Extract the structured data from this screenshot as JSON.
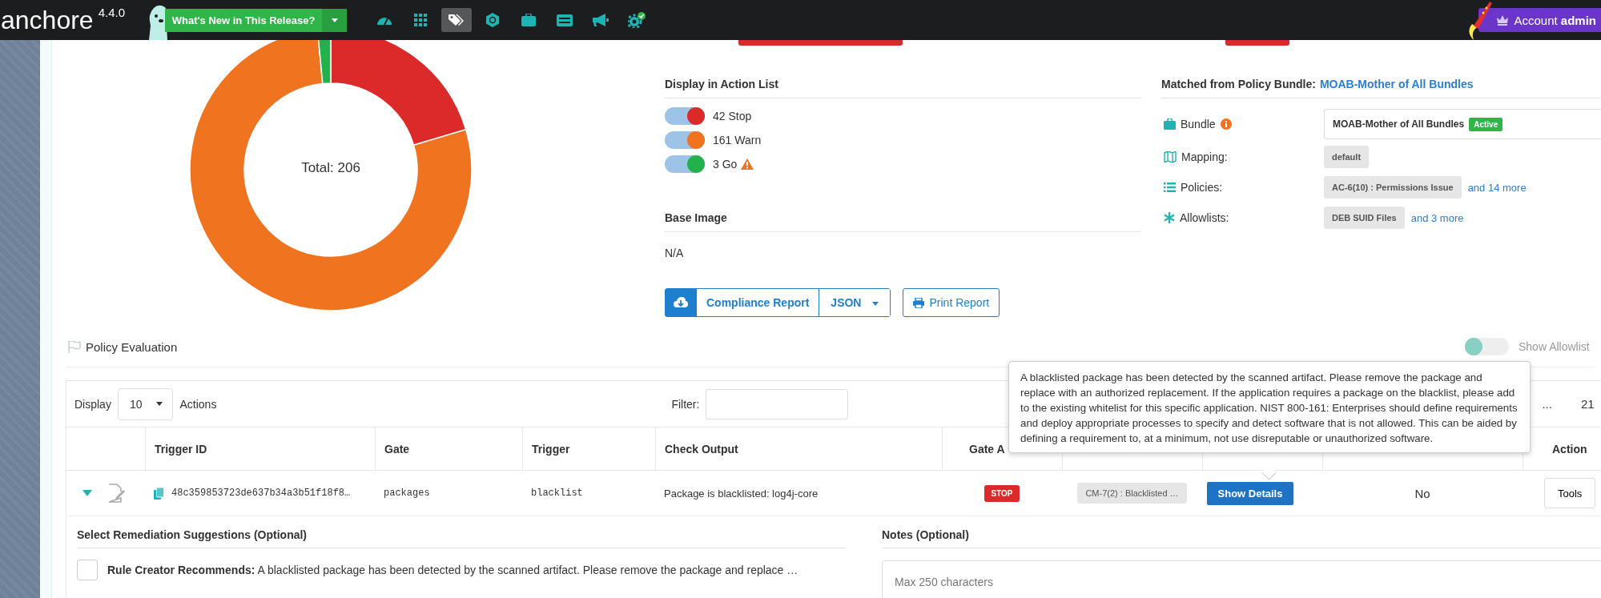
{
  "top_bar": {
    "logo": "anchore",
    "version": "4.4.0",
    "whats_new_button": "What's New in This Release?",
    "nav_icons": [
      {
        "kind": "gauge",
        "selected": false
      },
      {
        "kind": "grid",
        "selected": false
      },
      {
        "kind": "tags",
        "selected": true
      },
      {
        "kind": "network",
        "selected": false
      },
      {
        "kind": "briefcase",
        "selected": false
      },
      {
        "kind": "table",
        "selected": false
      },
      {
        "kind": "megaphone",
        "selected": false
      },
      {
        "kind": "gear",
        "selected": false
      }
    ],
    "account_button": "Account **admin**"
  },
  "chart": {
    "center_label": "Total: 206",
    "chart_data": {
      "type": "donut",
      "values": [
        20.4,
        78.1,
        1.5
      ]
    }
  },
  "action_list": {
    "title": "Display in Action List",
    "items": [
      {
        "label": "42 Stop",
        "color": "#dc2a2a",
        "on": true,
        "warning": false
      },
      {
        "label": "161 Warn",
        "color": "#f0731f",
        "on": true,
        "warning": false
      },
      {
        "label": "3 Go",
        "color": "#22b14c",
        "on": true,
        "warning": true
      }
    ]
  },
  "base_image": {
    "title": "Base Image",
    "value": "N/A"
  },
  "report_buttons": {
    "compliance": "Compliance Report",
    "format": "JSON",
    "print": "Print Report"
  },
  "policy_bundle": {
    "label": "Matched from Policy Bundle:",
    "link": "MOAB-Mother of All Bundles",
    "rows": [
      {
        "kind": "bundle",
        "label": "Bundle",
        "value": "MOAB-Mother of All Bundles",
        "badge": "Active"
      },
      {
        "kind": "mapping",
        "label": "Mapping:",
        "chip": "default"
      },
      {
        "kind": "policies",
        "label": "Policies:",
        "chip": "AC-6(10) : Permissions Issue",
        "more": "and 14 more"
      },
      {
        "kind": "allowlists",
        "label": "Allowlists:",
        "chip": "DEB SUID Files",
        "more": "and 3 more"
      }
    ]
  },
  "policy_evaluation": {
    "title": "Policy Evaluation",
    "show_allowlisted": {
      "label": "Show Allowlist",
      "on": false
    }
  },
  "table": {
    "display_label": "Display",
    "page_size": "10",
    "display_suffix": "Actions",
    "filter_label": "Filter:",
    "pagination": [
      "...",
      "21"
    ],
    "columns": [
      {
        "label": "Trigger ID"
      },
      {
        "label": "Gate"
      },
      {
        "label": "Trigger"
      },
      {
        "label": "Check Output"
      },
      {
        "label": "Gate A"
      },
      {
        "label": "Action"
      }
    ],
    "rows": [
      {
        "expanded": true,
        "trigger_id": "48c359853723de637b34a3b51f18f8…",
        "gate": "packages",
        "trigger": "blacklist",
        "check_output": "Package is blacklisted: log4j-core",
        "gate_action": {
          "kind": "stop",
          "label": "STOP"
        },
        "rule": "CM-7(2) : Blacklisted …",
        "details_button": "Show Details",
        "allowlisted": "No",
        "tools_button": "Tools"
      }
    ]
  },
  "remediation": {
    "title": "Select Remediation Suggestions (Optional)",
    "items": [
      {
        "checked": false,
        "text": "**Rule Creator Recommends:** A blacklisted package has been detected by the scanned artifact. Please remove the package and replace …"
      }
    ]
  },
  "notes": {
    "title": "Notes (Optional)",
    "placeholder": "Max 250 characters"
  },
  "tooltip": {
    "text": "A blacklisted package has been detected by the scanned artifact. Please remove the package and replace with an authorized replacement. If the application requires a package on the blacklist, please add to the existing whitelist for this specific application. NIST 800-161: Enterprises should define requirements and deploy appropriate processes to specify and detect software that is not allowed. This can be aided by defining a requirement to, at a minimum, not use disreputable or unauthorized software."
  }
}
